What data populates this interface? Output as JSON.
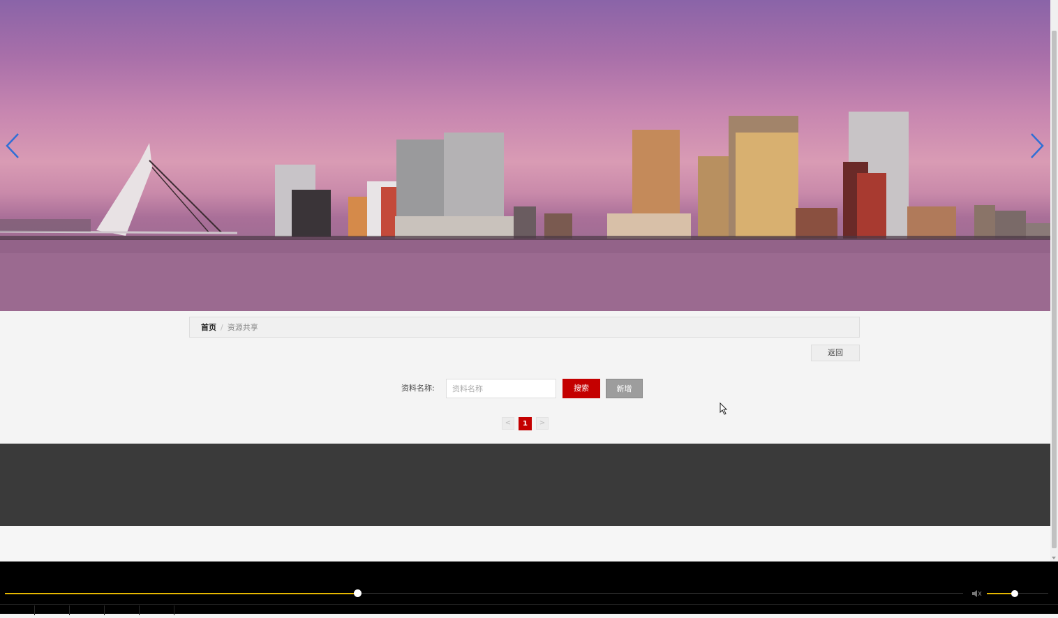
{
  "banner": {
    "image_alt": "city skyline at sunset with bridge",
    "prev_icon": "chevron-left-icon",
    "next_icon": "chevron-right-icon"
  },
  "breadcrumb": {
    "home": "首页",
    "separator": "/",
    "current": "资源共享"
  },
  "actions": {
    "back_label": "返回"
  },
  "search": {
    "label": "资料名称:",
    "placeholder": "资料名称",
    "value": "",
    "search_label": "搜索",
    "add_label": "新增"
  },
  "pagination": {
    "prev": "<",
    "current_page": "1",
    "next": ">"
  },
  "colors": {
    "accent": "#c40000",
    "footer": "#3a3a3a",
    "player_progress": "#e6b800"
  },
  "player": {
    "progress_fraction": 0.368,
    "volume_fraction": 0.45,
    "volume_icon": "speaker-icon"
  }
}
